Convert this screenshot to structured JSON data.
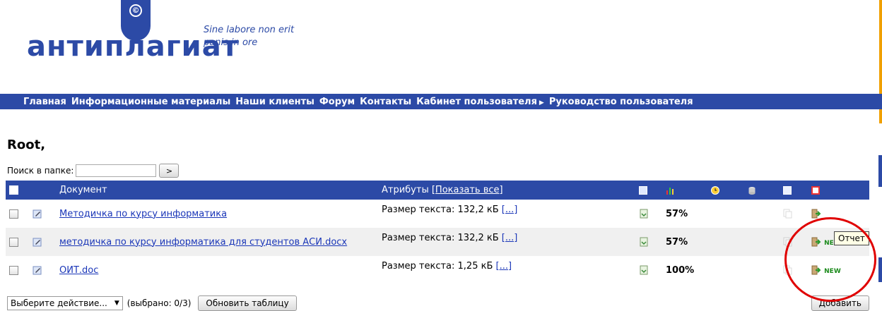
{
  "logo": {
    "symbol": "©",
    "brand_bold": "антиплагиат",
    "motto_line1": "Sine labore non erit",
    "motto_line2": "panis in ore"
  },
  "nav": {
    "items": [
      "Главная",
      "Информационные материалы",
      "Наши клиенты",
      "Форум",
      "Контакты",
      "Кабинет пользователя",
      "Руководство пользователя"
    ],
    "submenu_arrow": "▶"
  },
  "page": {
    "title": "Root,"
  },
  "search": {
    "label": "Поиск в папке:",
    "value": "",
    "button": ">"
  },
  "table": {
    "headers": {
      "document": "Документ",
      "attributes": "Атрибуты",
      "show_all": "[Показать все]"
    },
    "rows": [
      {
        "name": "Методичка по курсу информатика",
        "size": "Размер текста: 132,2 кБ",
        "more": "[...]",
        "percent": "57%",
        "new": ""
      },
      {
        "name": "методичка по курсу информатика для студентов АСИ.docx",
        "size": "Размер текста: 132,2 кБ",
        "more": "[...]",
        "percent": "57%",
        "new": "NEW"
      },
      {
        "name": "ОИТ.doc",
        "size": "Размер текста: 1,25 кБ",
        "more": "[...]",
        "percent": "100%",
        "new": "NEW"
      }
    ]
  },
  "tooltip": "Отчет",
  "footer": {
    "action_select": "Выберите действие...",
    "selected_count": "(выбрано: 0/3)",
    "update_button": "Обновить таблицу",
    "add_button": "Добавить"
  },
  "colors": {
    "brand_blue": "#2c4aa6",
    "link": "#1a36b8",
    "accent_orange": "#f0a000",
    "highlight_red": "#e00000"
  }
}
